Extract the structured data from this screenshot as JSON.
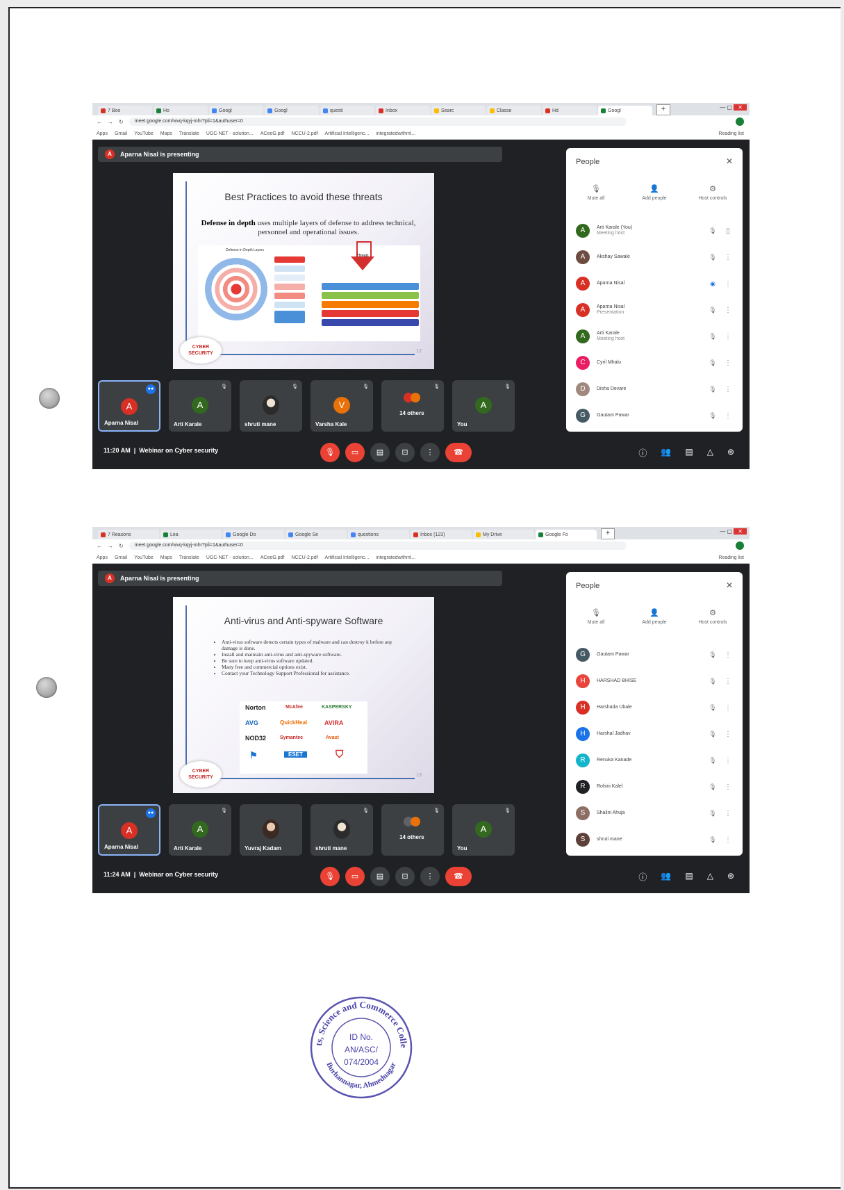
{
  "shots": [
    {
      "tabs": [
        "7 Boo",
        "Ho",
        "",
        "Googl",
        "Googl",
        "questi",
        "Inbox",
        "Searc",
        "Classe",
        "Hd",
        "Googl"
      ],
      "url": "meet.google.com/wvq-kqyj-mhr?pli=1&authuser=0",
      "bookmarks": [
        "Apps",
        "Gmail",
        "YouTube",
        "Maps",
        "Translate",
        "UGC-NET - solution...",
        "ACeeG.pdf",
        "NCCU-2.pdf",
        "Artificial Intelligenc...",
        "integratedwithml...",
        "Reading list"
      ],
      "presenting_banner": "Aparna Nisal is presenting",
      "presenter_avatar": "A",
      "slide": {
        "title": "Best Practices to avoid these threats",
        "body_bold": "Defense in depth",
        "body_rest": " uses multiple layers of defense to address technical, personnel and operational issues.",
        "image_caption": "Defense in Depth Layers",
        "arrow_label": "Threats",
        "badge_line1": "CYBER",
        "badge_line2": "SECURITY",
        "page": "12"
      },
      "tiles": [
        {
          "name": "Aparna Nisal",
          "initial": "A",
          "color": "#d93025",
          "selected": true
        },
        {
          "name": "Arti Karale",
          "initial": "A",
          "color": "#33691e"
        },
        {
          "name": "shruti mane",
          "initial": "",
          "photo": true
        },
        {
          "name": "Varsha Kale",
          "initial": "V",
          "color": "#e8710a"
        },
        {
          "name": "14 others",
          "initial": "",
          "others": true
        },
        {
          "name": "You",
          "initial": "A",
          "color": "#33691e"
        }
      ],
      "time": "11:20 AM",
      "meeting_name": "Webinar on Cyber security",
      "people": {
        "title": "People",
        "actions": [
          "Mute all",
          "Add people",
          "Host controls"
        ],
        "list": [
          {
            "name": "Arti Karale (You)",
            "sub": "Meeting host",
            "initial": "A",
            "color": "#33691e"
          },
          {
            "name": "Akshay Sawale",
            "initial": "A",
            "color": "#6d4c41"
          },
          {
            "name": "Aparna Nisal",
            "initial": "A",
            "color": "#d93025"
          },
          {
            "name": "Aparna Nisal",
            "sub": "Presentation",
            "initial": "A",
            "color": "#d93025"
          },
          {
            "name": "Arti Karale",
            "sub": "Meeting host",
            "initial": "A",
            "color": "#33691e"
          },
          {
            "name": "Cyril Mhalu",
            "initial": "C",
            "color": "#e91e63"
          },
          {
            "name": "Disha Devare",
            "initial": "D",
            "color": "#a1887f"
          },
          {
            "name": "Gautam Pawar",
            "initial": "G",
            "color": "#455a64"
          }
        ]
      }
    },
    {
      "tabs": [
        "7 Reasons",
        "Lea",
        "",
        "Google Do",
        "Google Se",
        "questions",
        "Inbox (123)",
        "My Drive",
        "Google Fo"
      ],
      "url": "meet.google.com/wvq-kqyj-mhr?pli=1&authuser=0",
      "bookmarks": [
        "Apps",
        "Gmail",
        "YouTube",
        "Maps",
        "Translate",
        "UGC-NET - solution...",
        "ACeeG.pdf",
        "NCCU-2.pdf",
        "Artificial Intelligenc...",
        "integratedwithml...",
        "Reading list"
      ],
      "presenting_banner": "Aparna Nisal is presenting",
      "presenter_avatar": "A",
      "slide": {
        "title": "Anti-virus and Anti-spyware Software",
        "bullets": [
          "Anti-virus software detects certain types of malware and can destroy it before any damage is done.",
          "Install and maintain anti-virus and anti-spyware software.",
          "Be sure to keep anti-virus software updated.",
          "Many free and commercial options exist.",
          "Contact your Technology Support Professional for assistance."
        ],
        "logos": [
          "Norton",
          "McAfee",
          "KASPERSKY",
          "AVG",
          "QuickHeal",
          "AVIRA",
          "NOD32",
          "Symantec",
          "Avast",
          "ESET"
        ],
        "badge_line1": "CYBER",
        "badge_line2": "SECURITY",
        "page": "13"
      },
      "tiles": [
        {
          "name": "Aparna Nisal",
          "initial": "A",
          "color": "#d93025",
          "selected": true
        },
        {
          "name": "Arti Karale",
          "initial": "A",
          "color": "#33691e"
        },
        {
          "name": "Yuvraj Kadam",
          "initial": "",
          "photo": true
        },
        {
          "name": "shruti mane",
          "initial": "",
          "photo": true
        },
        {
          "name": "14 others",
          "initial": "",
          "others": true
        },
        {
          "name": "You",
          "initial": "A",
          "color": "#33691e"
        }
      ],
      "time": "11:24 AM",
      "meeting_name": "Webinar on Cyber security",
      "people": {
        "title": "People",
        "actions": [
          "Mute all",
          "Add people",
          "Host controls"
        ],
        "list": [
          {
            "name": "Gautam Pawar",
            "initial": "G",
            "color": "#455a64"
          },
          {
            "name": "HARSHAD BHISE",
            "initial": "H",
            "color": "#e8453c"
          },
          {
            "name": "Harshada Ubale",
            "initial": "H",
            "color": "#d93025"
          },
          {
            "name": "Harshal Jadhav",
            "initial": "H",
            "color": "#1a73e8"
          },
          {
            "name": "Renuka Kanade",
            "initial": "R",
            "color": "#12b5cb"
          },
          {
            "name": "Rohini Kalel",
            "initial": "R",
            "color": "#202124"
          },
          {
            "name": "Shalini Ahuja",
            "initial": "S",
            "color": "#8d6e63"
          },
          {
            "name": "shruti mane",
            "initial": "S",
            "color": "#5d4037"
          }
        ]
      }
    }
  ],
  "seal": {
    "top_text": "Arts, Science and Commerce College",
    "bottom_text": "Burhannagar, Ahmednagar",
    "line1": "ID No.",
    "line2": "AN/ASC/",
    "line3": "074/2004"
  }
}
